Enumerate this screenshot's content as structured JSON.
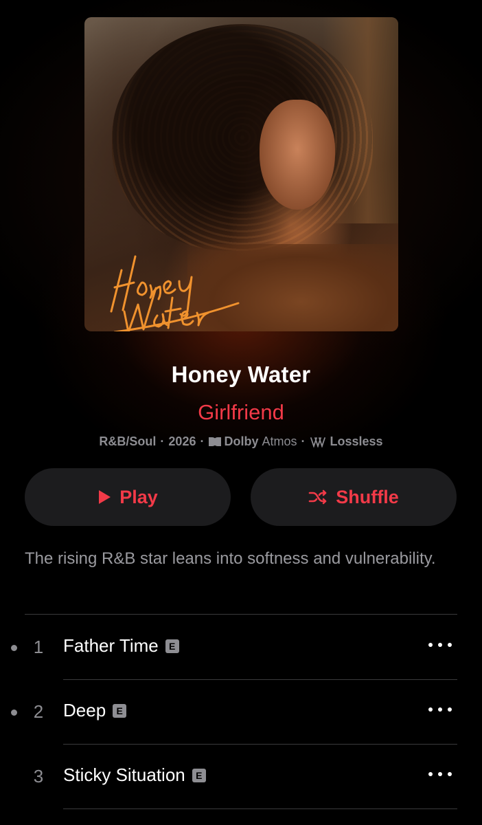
{
  "album": {
    "title": "Honey Water",
    "artist": "Girlfriend",
    "genre": "R&B/Soul",
    "year": "2026",
    "dolby_label": "Dolby",
    "atmos_label": "Atmos",
    "lossless_label": "Lossless",
    "artwork_title": "Honey Water",
    "description": "The rising R&B star leans into softness and vulnerability."
  },
  "buttons": {
    "play_label": "Play",
    "shuffle_label": "Shuffle"
  },
  "tracks": [
    {
      "number": "1",
      "title": "Father Time",
      "explicit": "E",
      "downloaded_dot": true
    },
    {
      "number": "2",
      "title": "Deep",
      "explicit": "E",
      "downloaded_dot": true
    },
    {
      "number": "3",
      "title": "Sticky Situation",
      "explicit": "E",
      "downloaded_dot": false
    }
  ],
  "colors": {
    "accent": "#f23a48",
    "background": "#000000",
    "button_bg": "#1c1c1e",
    "secondary_text": "#8d8d92"
  },
  "icons": {
    "play": "play-icon",
    "shuffle": "shuffle-icon",
    "dolby": "dolby-icon",
    "lossless": "lossless-icon",
    "more": "more-icon",
    "explicit": "explicit-badge"
  }
}
